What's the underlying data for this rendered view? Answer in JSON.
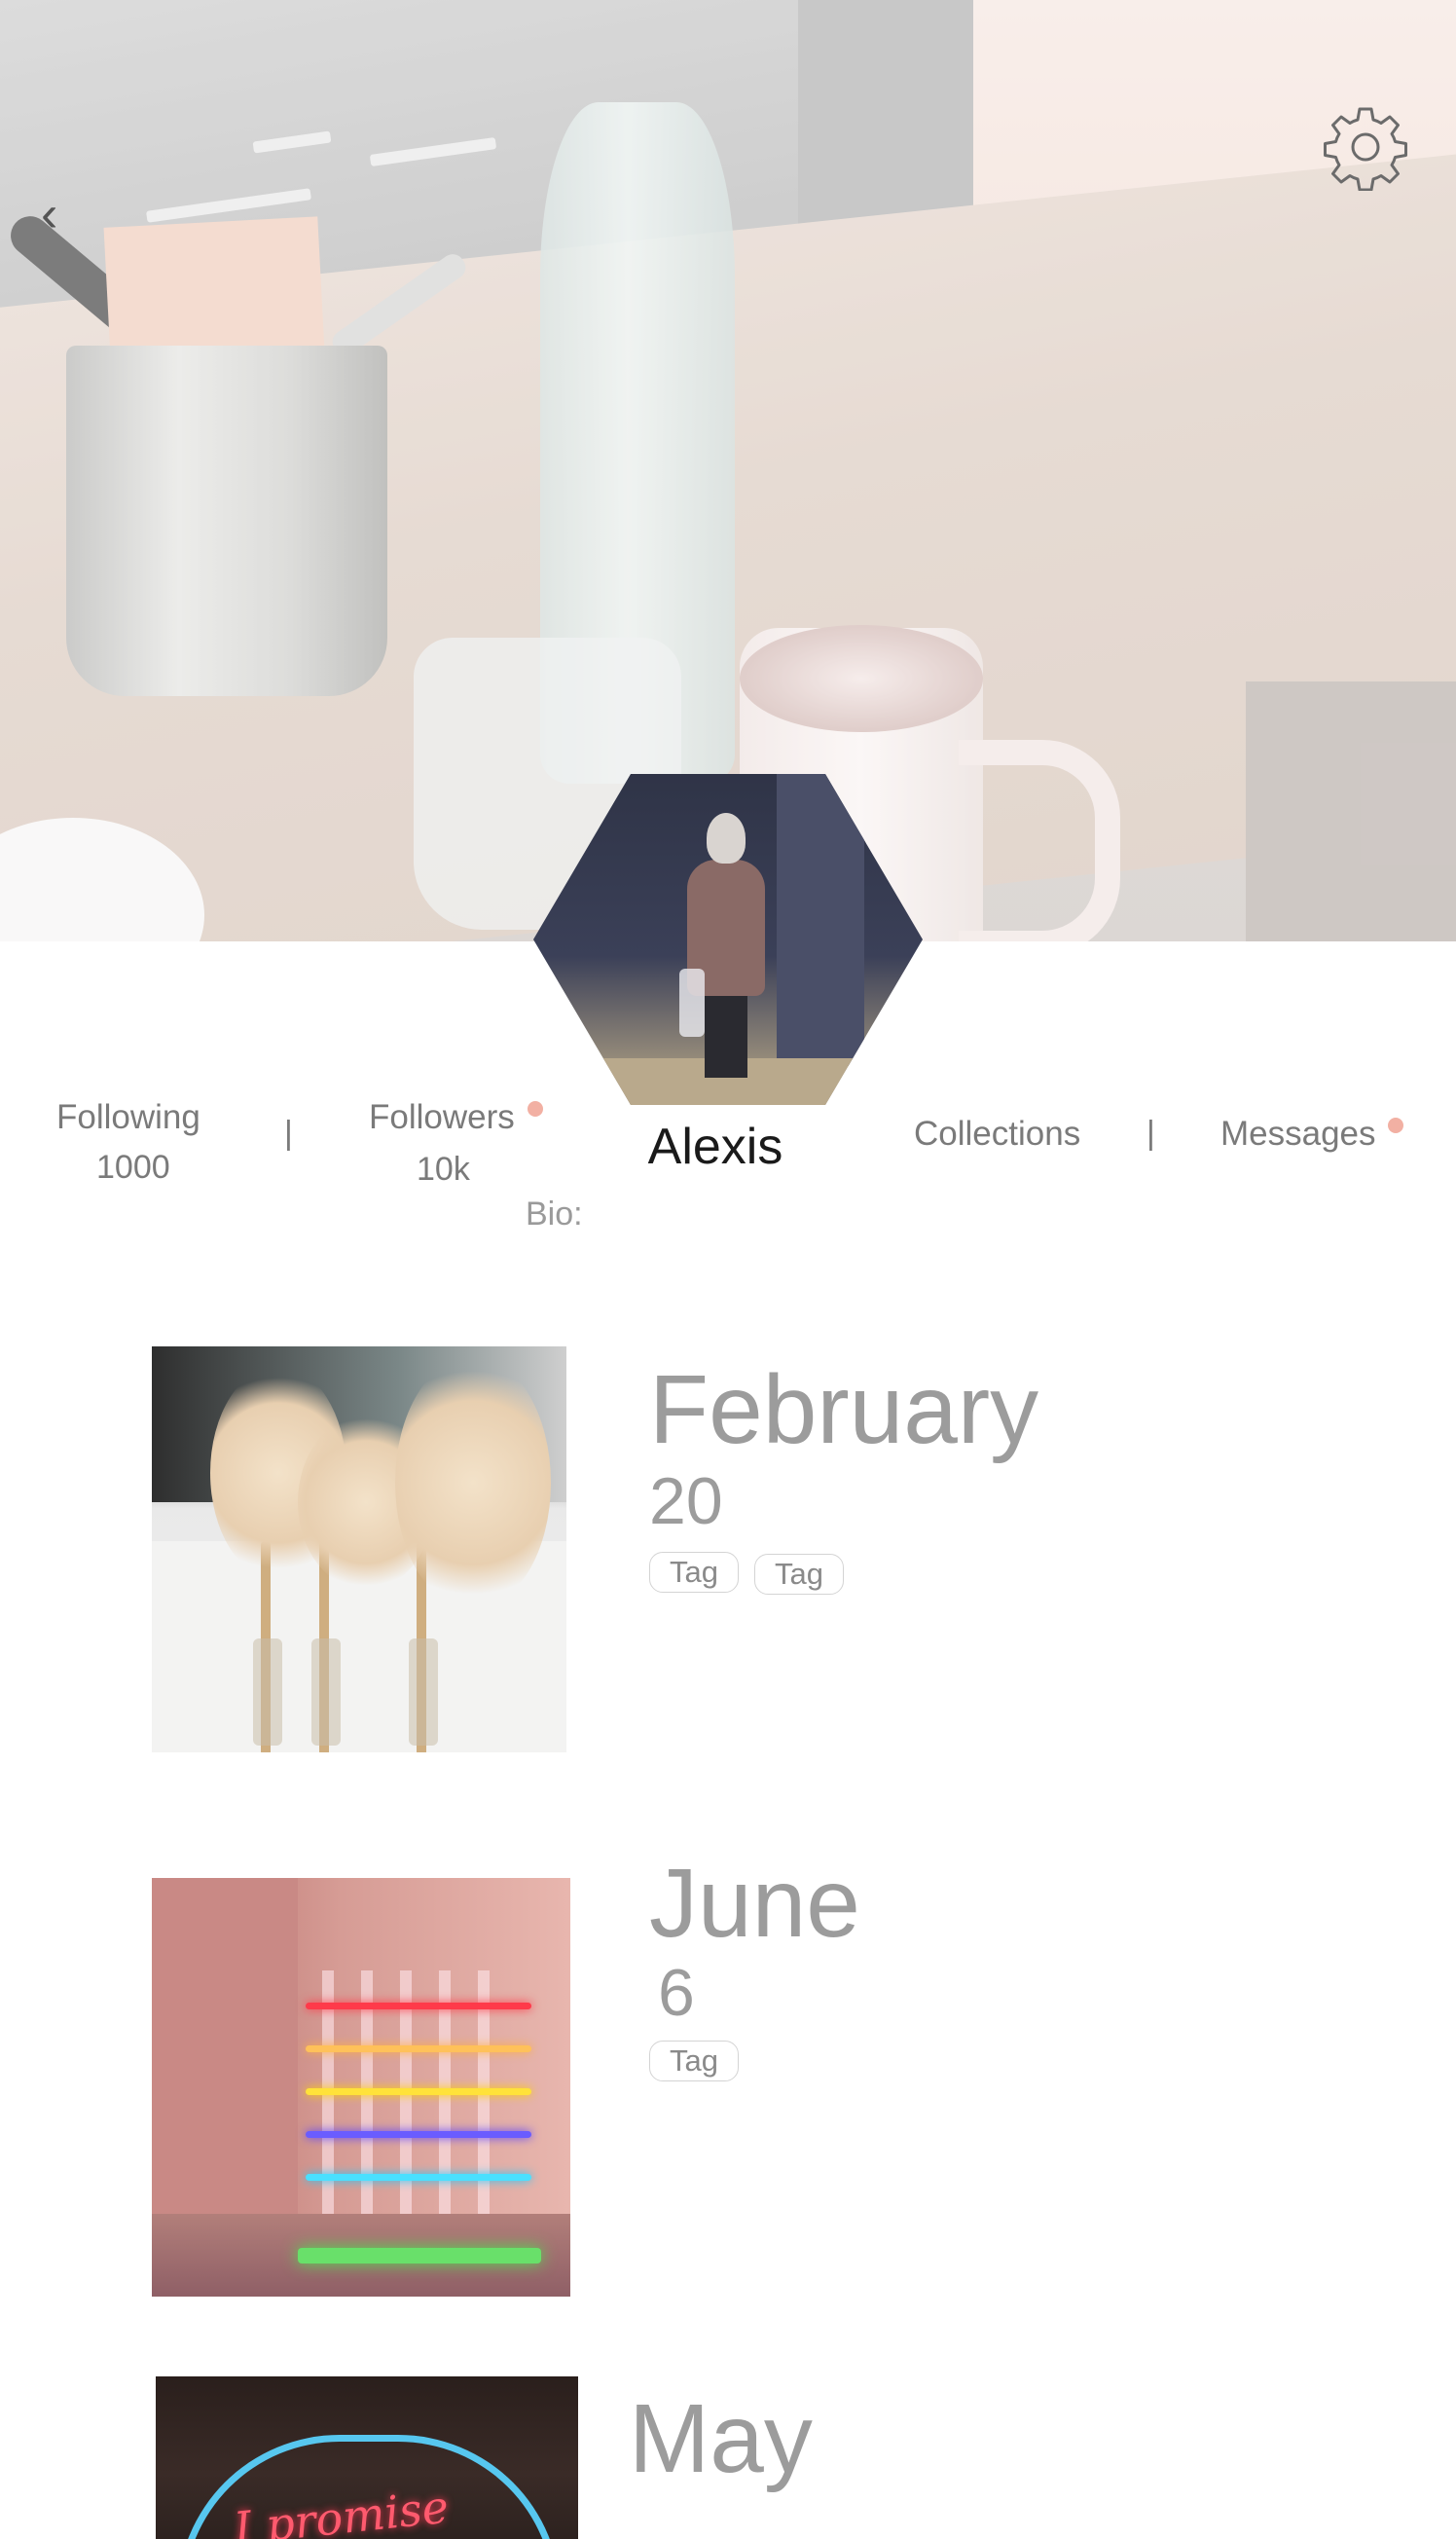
{
  "header": {
    "back_glyph": "‹",
    "icons": {
      "back": "chevron-left-icon",
      "settings": "gear-icon"
    }
  },
  "profile": {
    "name": "Alexis",
    "bio_label": "Bio:",
    "following": {
      "label": "Following",
      "value": "1000"
    },
    "followers": {
      "label": "Followers",
      "value": "10k",
      "has_notification": true
    },
    "collections_label": "Collections",
    "messages": {
      "label": "Messages",
      "has_notification": true
    },
    "divider_glyph": "|"
  },
  "posts": [
    {
      "month": "February",
      "day": "20",
      "tags": [
        "Tag",
        "Tag"
      ],
      "image": "pampas-grass-photo"
    },
    {
      "month": "June",
      "day": "6",
      "tags": [
        "Tag"
      ],
      "image": "neon-lights-photo"
    },
    {
      "month": "May",
      "day": "",
      "tags": [],
      "image": "neon-heart-photo"
    }
  ],
  "colors": {
    "text_muted": "#7a7a7a",
    "text_heading": "#9c9c9c",
    "notification_dot": "#f2b0a3",
    "name_text": "#1a1a1a"
  }
}
